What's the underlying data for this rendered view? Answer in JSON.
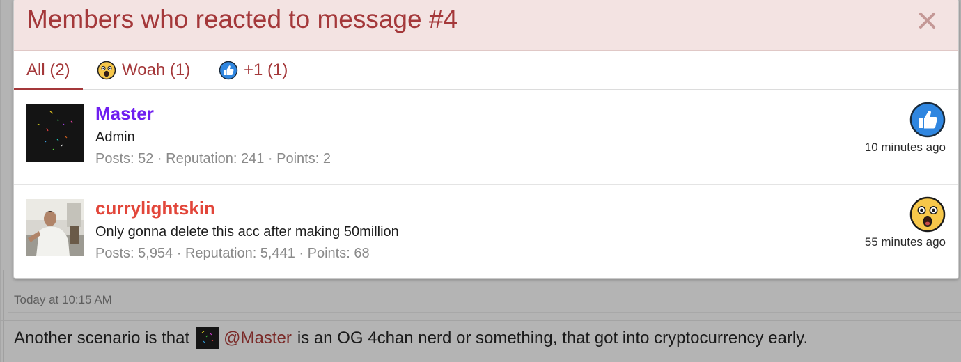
{
  "overlay": {
    "title": "Members who reacted to message #4",
    "close_symbol": "✕"
  },
  "tabs": [
    {
      "label": "All (2)",
      "emoji": ""
    },
    {
      "label": "Woah (1)",
      "emoji": "woah-icon"
    },
    {
      "label": "+1 (1)",
      "emoji": "thumbs-up-icon"
    }
  ],
  "members": [
    {
      "name": "Master",
      "name_color": "#6f1ef0",
      "title": "Admin",
      "stats": "Posts: 52 · Reputation: 241 · Points: 2",
      "reaction": "thumbs-up-icon",
      "time": "10 minutes ago"
    },
    {
      "name": "currylightskin",
      "name_color": "#e2463a",
      "title": "Only gonna delete this acc after making 50million",
      "stats": "Posts: 5,954 · Reputation: 5,441 · Points: 68",
      "reaction": "woah-icon",
      "time": "55 minutes ago"
    }
  ],
  "background_post": {
    "timestamp": "Today at 10:15 AM",
    "text_before": "Another scenario is that",
    "mention": "@Master",
    "text_after": "is an OG 4chan nerd or something, that got into cryptocurrency early."
  },
  "colors": {
    "accent": "#a4383a",
    "header_bg": "#f3e3e2",
    "thumbs_blue": "#2f86e0",
    "woah_yellow": "#f6c74a"
  }
}
